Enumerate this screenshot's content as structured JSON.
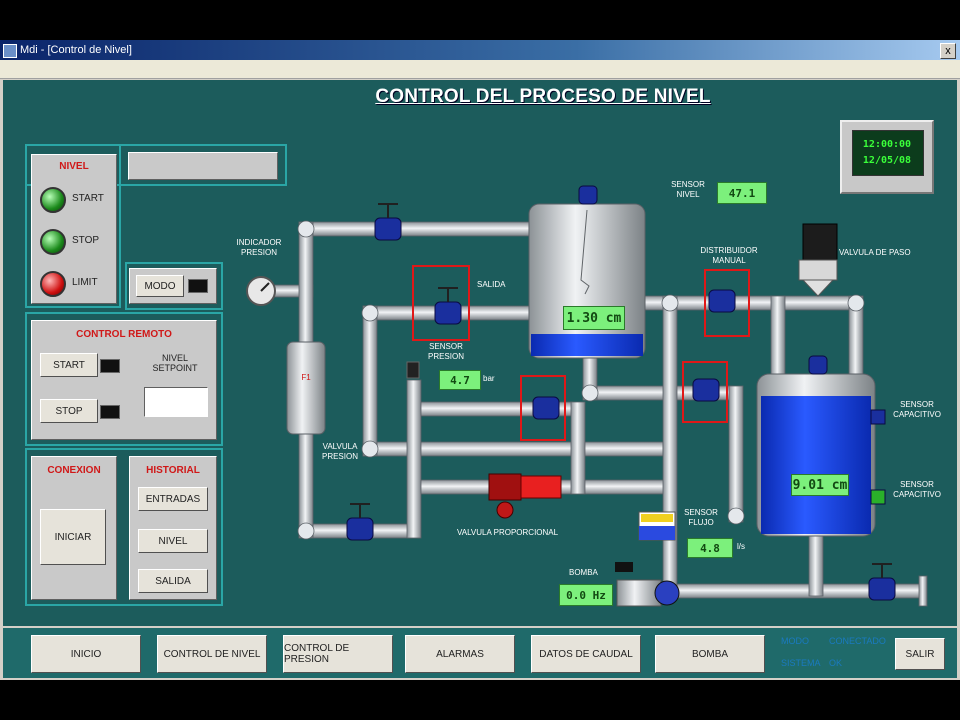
{
  "window": {
    "title": "Mdi - [Control de Nivel]",
    "close_label": "x"
  },
  "heading": "CONTROL DEL PROCESO DE NIVEL",
  "left_panel": {
    "estado": {
      "title": "NIVEL",
      "lamps": [
        {
          "label": "START",
          "color": "green"
        },
        {
          "label": "STOP",
          "color": "green"
        },
        {
          "label": "LIMIT",
          "color": "red"
        }
      ]
    },
    "message_box": "",
    "modo_button": "MODO",
    "control_remoto": {
      "title": "CONTROL REMOTO",
      "start_button": "START",
      "stop_button": "STOP",
      "setpoint_label": "NIVEL SETPOINT"
    },
    "conexion": {
      "title": "CONEXION",
      "button": "INICIAR"
    },
    "historial": {
      "title": "HISTORIAL",
      "buttons": [
        "ENTRADAS",
        "NIVEL",
        "SALIDA"
      ]
    }
  },
  "clock": {
    "line1": "12:00:00",
    "line2": "12/05/08"
  },
  "diagram": {
    "labels": {
      "indicador_presion": "INDICADOR PRESION",
      "sensor_nivel": "SENSOR NIVEL",
      "sensor_nivel_value": "47.1",
      "tank1_value": "1.30 cm",
      "salida": "SALIDA",
      "sensor_presion": "SENSOR PRESION",
      "sensor_presion_value": "4.7",
      "sensor_presion_unit": "bar",
      "valvula_presion": "VALVULA PRESION",
      "filtro": "FILTRO",
      "valvula_proporcional": "VALVULA PROPORCIONAL",
      "distribuidor_manual": "DISTRIBUIDOR MANUAL",
      "valvula_de_paso": "VALVULA DE PASO",
      "sensor_capacitivo_1": "SENSOR CAPACITIVO",
      "sensor_capacitivo_2": "SENSOR CAPACITIVO",
      "tank2_value": "9.01 cm",
      "sensor_flujo": "SENSOR FLUJO",
      "sensor_flujo_value": "4.8",
      "sensor_flujo_unit": "l/s",
      "bomba": "BOMBA",
      "bomba_value": "0.0 Hz"
    }
  },
  "footer": {
    "buttons": [
      "INICIO",
      "CONTROL DE NIVEL",
      "CONTROL DE PRESION",
      "ALARMAS",
      "DATOS DE CAUDAL",
      "BOMBA",
      "SALIR"
    ],
    "legend": [
      "MODO",
      "CONECTADO",
      "SISTEMA",
      "OK"
    ]
  },
  "colors": {
    "background": "#1c5c5c",
    "pipe": "#c8cdd2",
    "water": "#1040e0",
    "lcd": "#7cf07c",
    "alarm": "#d01818"
  }
}
